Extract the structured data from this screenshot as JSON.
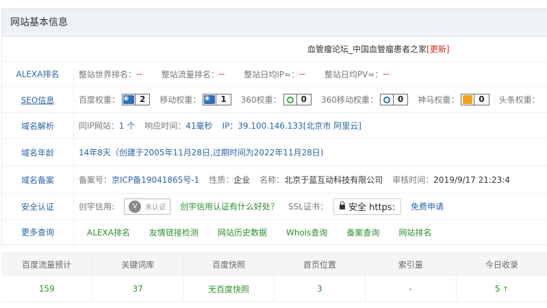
{
  "panel": {
    "title": "网站基本信息"
  },
  "site": {
    "name": "血管瘤论坛_中国血管瘤患者之家",
    "update_label": "[更新]"
  },
  "alexa": {
    "label": "ALEXA排名",
    "items": [
      {
        "name": "整站世界排名：",
        "value": "--"
      },
      {
        "name": "整站流量排名：",
        "value": "--"
      },
      {
        "name": "整站日均IP≈：",
        "value": "--"
      },
      {
        "name": "整站日均PV≈：",
        "value": "--"
      }
    ]
  },
  "seo": {
    "label": "SEO信息",
    "baidu": {
      "name": "百度权重：",
      "value": "2"
    },
    "mobile": {
      "name": "移动权重：",
      "value": "1"
    },
    "so360": {
      "name": "360权重：",
      "value": "0"
    },
    "so360m": {
      "name": "360移动权重：",
      "value": "0"
    },
    "shenma": {
      "name": "神马权重：",
      "value": "0"
    },
    "toutiao": {
      "name": "头条权重："
    }
  },
  "dns": {
    "label": "域名解析",
    "same_ip_name": "同IP网站：",
    "same_ip_value": "1 个",
    "resp_name": "响应时间：",
    "resp_value": "41毫秒",
    "ip_name": "IP：",
    "ip_value": "39.100.146.133[北京市 阿里云]"
  },
  "age": {
    "label": "域名年龄",
    "value": "14年8天（创建于2005年11月28日,过期时间为2022年11月28日)"
  },
  "icp": {
    "label": "域名备案",
    "no_name": "备案号：",
    "no_value": "京ICP备19041865号-1",
    "type_name": "性质：",
    "type_value": "企业",
    "org_name": "名称：",
    "org_value": "北京于蓝互动科技有限公司",
    "time_name": "审核时间：",
    "time_value": "2019/9/17 21:23:4"
  },
  "security": {
    "label": "安全认证",
    "credit_name": "创宇信用:",
    "cert_mark": "V",
    "cert_text": "未认证",
    "credit_link": "创宇信用认证有什么好处？",
    "ssl_name": "SSL证书：",
    "ssl_badge": "安全 https:",
    "apply_link": "免费申请"
  },
  "more": {
    "label": "更多查询",
    "links": [
      "ALEXA排名",
      "友情链接检测",
      "网站历史数据",
      "Whois查询",
      "备案查询",
      "网站排名"
    ]
  },
  "stats": {
    "headers": [
      "百度流量预计",
      "关键词库",
      "百度快照",
      "首页位置",
      "索引量",
      "今日收录"
    ],
    "values": [
      "159",
      "37",
      "无百度快照",
      "3",
      "-",
      "5"
    ],
    "up_arrow": "↑"
  },
  "colors": {
    "link": "#2a64a8",
    "green": "#2d8f2d",
    "red": "#e2231a"
  }
}
